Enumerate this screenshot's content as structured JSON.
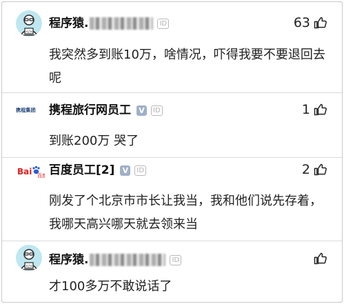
{
  "comments": [
    {
      "name": "程序猿.",
      "likes": "63",
      "text": "我突然多到账10万，啥情况，吓得我要不要退回去呢",
      "id_badge": "ID"
    },
    {
      "name": "携程旅行网员工",
      "likes": "1",
      "text": "到账200万 哭了",
      "id_badge": "ID",
      "logo_text": "携程集团"
    },
    {
      "name": "百度员工[2]",
      "likes": "2",
      "text": "刚发了个北京市市长让我当，我和他们说先存着，我哪天高兴哪天就去领来当",
      "id_badge": "ID",
      "logo_text": "百度"
    },
    {
      "name": "程序猿.",
      "likes": "",
      "text": "才100多万不敢说话了",
      "id_badge": "ID"
    }
  ],
  "colors": {
    "avatar_bg": "#bfe7ef",
    "divider": "#d9d9d9",
    "verified_badge": "#9fb0c8"
  },
  "icons": {
    "like": "thumbs-up-icon"
  }
}
